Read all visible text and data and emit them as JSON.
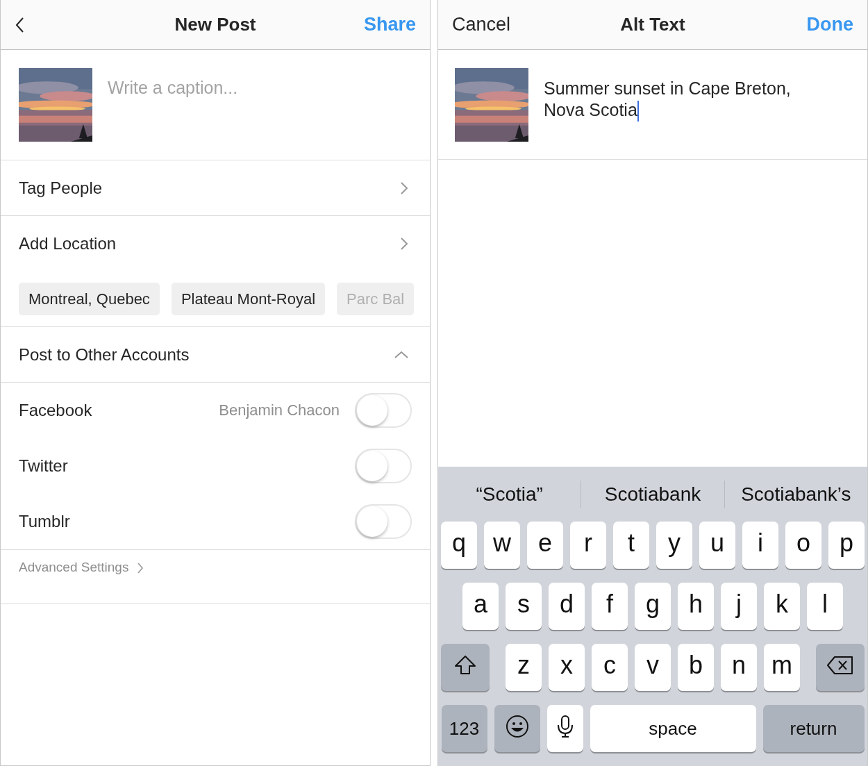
{
  "new_post": {
    "header": {
      "title": "New Post",
      "action": "Share"
    },
    "caption": {
      "placeholder": "Write a caption..."
    },
    "rows": [
      {
        "label": "Tag People"
      },
      {
        "label": "Add Location"
      }
    ],
    "location_suggestions": [
      {
        "label": "Montreal, Quebec",
        "faded": false
      },
      {
        "label": "Plateau Mont-Royal",
        "faded": false
      },
      {
        "label": "Parc Bal",
        "faded": true
      }
    ],
    "other_accounts": {
      "label": "Post to Other Accounts",
      "expanded": true,
      "accounts": [
        {
          "name": "Facebook",
          "user": "Benjamin Chacon",
          "on": false
        },
        {
          "name": "Twitter",
          "on": false
        },
        {
          "name": "Tumblr",
          "on": false
        }
      ]
    },
    "advanced_settings": "Advanced Settings"
  },
  "alt_text": {
    "header": {
      "cancel": "Cancel",
      "title": "Alt Text",
      "done": "Done"
    },
    "value": "Summer sunset in Cape Breton, Nova Scotia",
    "keyboard": {
      "suggestions": [
        "“Scotia”",
        "Scotiabank",
        "Scotiabank’s"
      ],
      "top_row": [
        {
          "kind": "letter",
          "label": "q"
        },
        {
          "kind": "letter",
          "label": "w"
        },
        {
          "kind": "letter",
          "label": "e"
        },
        {
          "kind": "letter",
          "label": "r"
        },
        {
          "kind": "letter",
          "label": "t"
        },
        {
          "kind": "letter",
          "label": "y"
        },
        {
          "kind": "letter",
          "label": "u"
        },
        {
          "kind": "letter",
          "label": "i"
        },
        {
          "kind": "letter",
          "label": "o"
        },
        {
          "kind": "letter",
          "label": "p"
        }
      ],
      "middle_row": [
        {
          "kind": "letter",
          "label": "a"
        },
        {
          "kind": "letter",
          "label": "s"
        },
        {
          "kind": "letter",
          "label": "d"
        },
        {
          "kind": "letter",
          "label": "f"
        },
        {
          "kind": "letter",
          "label": "g"
        },
        {
          "kind": "letter",
          "label": "h"
        },
        {
          "kind": "letter",
          "label": "j"
        },
        {
          "kind": "letter",
          "label": "k"
        },
        {
          "kind": "letter",
          "label": "l"
        }
      ],
      "bottom_row": [
        {
          "kind": "shift"
        },
        {
          "kind": "letter",
          "label": "z"
        },
        {
          "kind": "letter",
          "label": "x"
        },
        {
          "kind": "letter",
          "label": "c"
        },
        {
          "kind": "letter",
          "label": "v"
        },
        {
          "kind": "letter",
          "label": "b"
        },
        {
          "kind": "letter",
          "label": "n"
        },
        {
          "kind": "letter",
          "label": "m"
        },
        {
          "kind": "backspace"
        }
      ],
      "function_row": [
        {
          "kind": "numbers",
          "label": "123"
        },
        {
          "kind": "emoji"
        },
        {
          "kind": "mic"
        },
        {
          "kind": "space",
          "label": "space"
        },
        {
          "kind": "return",
          "label": "return"
        }
      ]
    }
  }
}
